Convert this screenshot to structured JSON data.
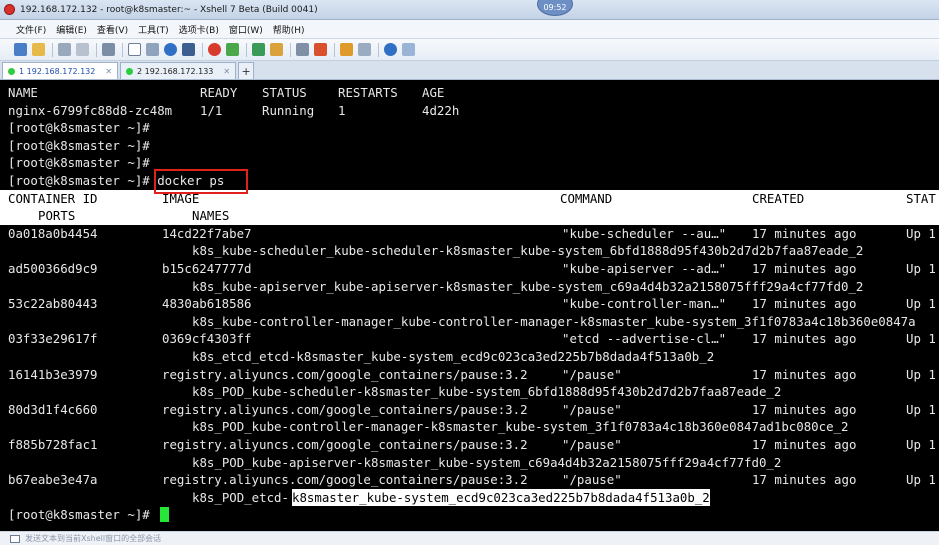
{
  "window": {
    "title": "192.168.172.132 - root@k8smaster:~ - Xshell 7 Beta (Build 0041)",
    "clock": "09:52"
  },
  "menu": [
    "文件(F)",
    "编辑(E)",
    "查看(V)",
    "工具(T)",
    "选项卡(B)",
    "窗口(W)",
    "帮助(H)"
  ],
  "tabs": [
    {
      "label": "1 192.168.172.132",
      "status_color": "#2ecc40",
      "active": true
    },
    {
      "label": "2 192.168.172.133",
      "status_color": "#2ecc40",
      "active": false
    }
  ],
  "terminal": {
    "lines": [
      {
        "segments": [
          {
            "t": "NAME"
          },
          {
            "t": "READY"
          },
          {
            "t": "STATUS"
          },
          {
            "t": "RESTARTS"
          },
          {
            "t": "AGE"
          }
        ]
      },
      {
        "segments": [
          {
            "t": "nginx-6799fc88d8-zc48m"
          },
          {
            "t": "1/1"
          },
          {
            "t": "Running"
          },
          {
            "t": "1"
          },
          {
            "t": "4d22h"
          }
        ]
      },
      {
        "segments": [
          {
            "t": "[root@k8smaster ~]#"
          }
        ]
      },
      {
        "segments": [
          {
            "t": "[root@k8smaster ~]#"
          }
        ]
      },
      {
        "segments": [
          {
            "t": "[root@k8smaster ~]#"
          }
        ]
      },
      {
        "segments": [
          {
            "t": "[root@k8smaster ~]# docker ps"
          }
        ]
      },
      {
        "segments": [
          {
            "t": "CONTAINER ID"
          },
          {
            "t": "IMAGE"
          },
          {
            "t": "COMMAND"
          },
          {
            "t": "CREATED"
          },
          {
            "t": "STAT"
          }
        ]
      },
      {
        "segments": [
          {
            "t": "PORTS"
          },
          {
            "t": "NAMES"
          }
        ]
      },
      {
        "segments": [
          {
            "t": "0a018a0b4454"
          },
          {
            "t": "14cd22f7abe7"
          },
          {
            "t": "\"kube-scheduler --au…\""
          },
          {
            "t": "17 minutes ago"
          },
          {
            "t": "Up 1"
          }
        ]
      },
      {
        "segments": [
          {
            "t": "k8s_kube-scheduler_kube-scheduler-k8smaster_kube-system_6bfd1888d95f430b2d7d2b7faa87eade_2"
          }
        ]
      },
      {
        "segments": [
          {
            "t": "ad500366d9c9"
          },
          {
            "t": "b15c6247777d"
          },
          {
            "t": "\"kube-apiserver --ad…\""
          },
          {
            "t": "17 minutes ago"
          },
          {
            "t": "Up 1"
          }
        ]
      },
      {
        "segments": [
          {
            "t": "k8s_kube-apiserver_kube-apiserver-k8smaster_kube-system_c69a4d4b32a2158075fff29a4cf77fd0_2"
          }
        ]
      },
      {
        "segments": [
          {
            "t": "53c22ab80443"
          },
          {
            "t": "4830ab618586"
          },
          {
            "t": "\"kube-controller-man…\""
          },
          {
            "t": "17 minutes ago"
          },
          {
            "t": "Up 1"
          }
        ]
      },
      {
        "segments": [
          {
            "t": "k8s_kube-controller-manager_kube-controller-manager-k8smaster_kube-system_3f1f0783a4c18b360e0847a"
          }
        ]
      },
      {
        "segments": [
          {
            "t": "03f33e29617f"
          },
          {
            "t": "0369cf4303ff"
          },
          {
            "t": "\"etcd --advertise-cl…\""
          },
          {
            "t": "17 minutes ago"
          },
          {
            "t": "Up 1"
          }
        ]
      },
      {
        "segments": [
          {
            "t": "k8s_etcd_etcd-k8smaster_kube-system_ecd9c023ca3ed225b7b8dada4f513a0b_2"
          }
        ]
      },
      {
        "segments": [
          {
            "t": "16141b3e3979"
          },
          {
            "t": "registry.aliyuncs.com/google_containers/pause:3.2"
          },
          {
            "t": "\"/pause\""
          },
          {
            "t": "17 minutes ago"
          },
          {
            "t": "Up 1"
          }
        ]
      },
      {
        "segments": [
          {
            "t": "k8s_POD_kube-scheduler-k8smaster_kube-system_6bfd1888d95f430b2d7d2b7faa87eade_2"
          }
        ]
      },
      {
        "segments": [
          {
            "t": "80d3d1f4c660"
          },
          {
            "t": "registry.aliyuncs.com/google_containers/pause:3.2"
          },
          {
            "t": "\"/pause\""
          },
          {
            "t": "17 minutes ago"
          },
          {
            "t": "Up 1"
          }
        ]
      },
      {
        "segments": [
          {
            "t": "k8s_POD_kube-controller-manager-k8smaster_kube-system_3f1f0783a4c18b360e0847ad1bc080ce_2"
          }
        ]
      },
      {
        "segments": [
          {
            "t": "f885b728fac1"
          },
          {
            "t": "registry.aliyuncs.com/google_containers/pause:3.2"
          },
          {
            "t": "\"/pause\""
          },
          {
            "t": "17 minutes ago"
          },
          {
            "t": "Up 1"
          }
        ]
      },
      {
        "segments": [
          {
            "t": "k8s_POD_kube-apiserver-k8smaster_kube-system_c69a4d4b32a2158075fff29a4cf77fd0_2"
          }
        ]
      },
      {
        "segments": [
          {
            "t": "b67eabe3e47a"
          },
          {
            "t": "registry.aliyuncs.com/google_containers/pause:3.2"
          },
          {
            "t": "\"/pause\""
          },
          {
            "t": "17 minutes ago"
          },
          {
            "t": "Up 1"
          }
        ]
      },
      {
        "segments": [
          {
            "t": "k8s_POD_etcd-"
          },
          {
            "t": "k8smaster_kube-system_ecd9c023ca3ed225b7b8dada4f513a0b_2"
          }
        ]
      },
      {
        "segments": [
          {
            "t": "[root@k8smaster ~]#"
          }
        ]
      }
    ],
    "highlight_color": "#ffffff",
    "cursor_color": "#27e63a",
    "annotation_color": "#e0211c"
  },
  "statusbar": {
    "text": "发送文本到当前Xshell窗口的全部会话"
  }
}
